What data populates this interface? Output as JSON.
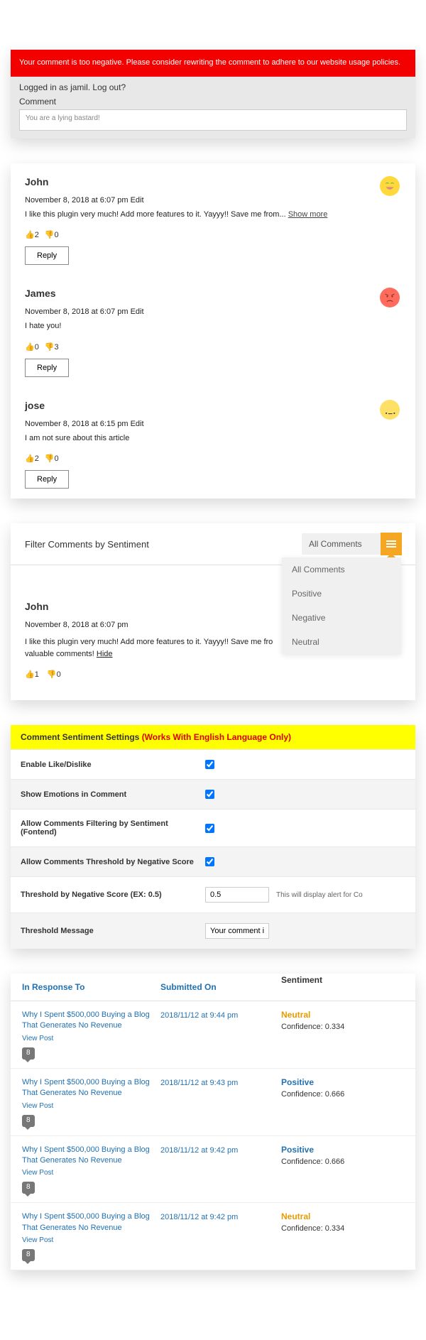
{
  "error": {
    "message": "Your comment is too negative. Please consider rewriting the comment to adhere to our website usage policies."
  },
  "form": {
    "login_prefix": "Logged in as ",
    "username": "jamil",
    "logout_text": ". Log out?",
    "comment_label": "Comment",
    "comment_value": "You are a lying bastard!"
  },
  "comments": [
    {
      "author": "John",
      "date": "November 8, 2018 at 6:07 pm",
      "edit": "Edit",
      "text": "I like this plugin very much! Add more features to it. Yayyy!! Save me from... ",
      "show_more": "Show more",
      "likes": "2",
      "dislikes": "0",
      "reply": "Reply",
      "emoji": "happy"
    },
    {
      "author": "James",
      "date": "November 8, 2018 at 6:07 pm",
      "edit": "Edit",
      "text": "I hate you!",
      "show_more": "",
      "likes": "0",
      "dislikes": "3",
      "reply": "Reply",
      "emoji": "angry"
    },
    {
      "author": "jose",
      "date": "November 8, 2018 at 6:15 pm",
      "edit": "Edit",
      "text": "I am not sure about this article",
      "show_more": "",
      "likes": "2",
      "dislikes": "0",
      "reply": "Reply",
      "emoji": "neutral"
    }
  ],
  "filter": {
    "title": "Filter Comments by Sentiment",
    "selected": "All Comments",
    "options": [
      "All Comments",
      "Positive",
      "Negative",
      "Neutral"
    ],
    "comment": {
      "author": "John",
      "date": "November 8, 2018 at 6:07 pm",
      "text_pre": "I like this plugin very much! Add more features to it. Yayyy!! Save me fro",
      "text_post": "valuable comments! ",
      "hide": "Hide",
      "likes": "1",
      "dislikes": "0"
    }
  },
  "settings": {
    "header_main": "Comment Sentiment Settings ",
    "header_note": "(Works With English Language Only)",
    "rows": {
      "enable_like": "Enable Like/Dislike",
      "show_emotions": "Show Emotions in Comment",
      "allow_filtering": "Allow Comments Filtering by Sentiment (Fontend)",
      "allow_threshold": "Allow Comments Threshold by Negative Score",
      "threshold_score": "Threshold by Negative Score (EX: 0.5)",
      "threshold_value": "0.5",
      "threshold_help": "This will display alert for Co",
      "threshold_msg_label": "Threshold Message",
      "threshold_msg_value": "Your comment is too negative. Please consider rew"
    }
  },
  "admin": {
    "headers": {
      "response": "In Response To",
      "submitted": "Submitted On",
      "sentiment": "Sentiment"
    },
    "rows": [
      {
        "title": "Why I Spent $500,000 Buying a Blog That Generates No Revenue",
        "view": "View Post",
        "count": "8",
        "date": "2018/11/12 at 9:44 pm",
        "sentiment": "Neutral",
        "sent_class": "neutral",
        "confidence": "Confidence: 0.334"
      },
      {
        "title": "Why I Spent $500,000 Buying a Blog That Generates No Revenue",
        "view": "View Post",
        "count": "8",
        "date": "2018/11/12 at 9:43 pm",
        "sentiment": "Positive",
        "sent_class": "positive",
        "confidence": "Confidence: 0.666"
      },
      {
        "title": "Why I Spent $500,000 Buying a Blog That Generates No Revenue",
        "view": "View Post",
        "count": "8",
        "date": "2018/11/12 at 9:42 pm",
        "sentiment": "Positive",
        "sent_class": "positive",
        "confidence": "Confidence: 0.666"
      },
      {
        "title": "Why I Spent $500,000 Buying a Blog That Generates No Revenue",
        "view": "View Post",
        "count": "8",
        "date": "2018/11/12 at 9:42 pm",
        "sentiment": "Neutral",
        "sent_class": "neutral",
        "confidence": "Confidence: 0.334"
      }
    ]
  }
}
